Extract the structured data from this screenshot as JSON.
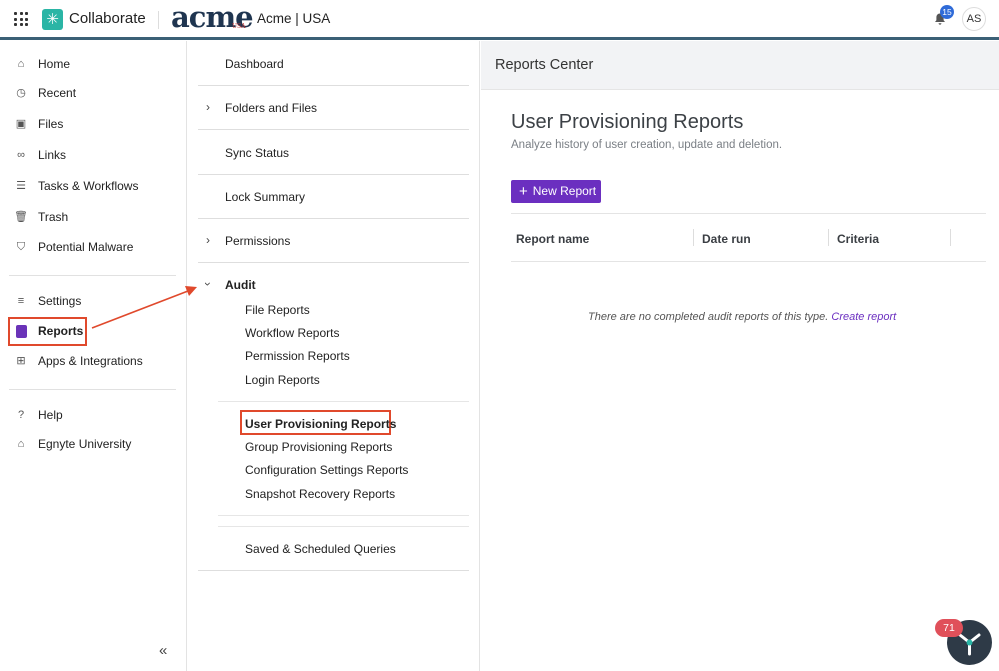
{
  "topbar": {
    "app_name": "Collaborate",
    "brand": "acme",
    "brand_sub": "USA",
    "tenant": "Acme | USA",
    "notification_count": "15",
    "avatar_initials": "AS"
  },
  "sidebar": {
    "items": [
      {
        "label": "Home",
        "icon": "home-icon"
      },
      {
        "label": "Recent",
        "icon": "clock-icon"
      },
      {
        "label": "Files",
        "icon": "files-icon"
      },
      {
        "label": "Links",
        "icon": "link-icon"
      },
      {
        "label": "Tasks & Workflows",
        "icon": "tasks-icon"
      },
      {
        "label": "Trash",
        "icon": "trash-icon"
      },
      {
        "label": "Potential Malware",
        "icon": "shield-icon"
      },
      {
        "label": "Settings",
        "icon": "sliders-icon"
      },
      {
        "label": "Reports",
        "icon": "reports-icon"
      },
      {
        "label": "Apps & Integrations",
        "icon": "apps-icon"
      },
      {
        "label": "Help",
        "icon": "help-icon"
      },
      {
        "label": "Egnyte University",
        "icon": "graduation-cap-icon"
      }
    ],
    "collapse_label": "«"
  },
  "reports_nav": {
    "dashboard": "Dashboard",
    "folders_and_files": "Folders and Files",
    "sync_status": "Sync Status",
    "lock_summary": "Lock Summary",
    "permissions": "Permissions",
    "audit": "Audit",
    "audit_items_1": [
      "File Reports",
      "Workflow Reports",
      "Permission Reports",
      "Login Reports"
    ],
    "audit_items_2": [
      "User Provisioning Reports",
      "Group Provisioning Reports",
      "Configuration Settings Reports",
      "Snapshot Recovery Reports"
    ],
    "saved_queries": "Saved & Scheduled Queries"
  },
  "main": {
    "header_title": "Reports Center",
    "title": "User Provisioning Reports",
    "subtitle": "Analyze history of user creation, update and deletion.",
    "new_report_button": "New Report",
    "columns": [
      "Report name",
      "Date run",
      "Criteria"
    ],
    "empty_text": "There are no completed audit reports of this type.",
    "empty_link": "Create report"
  },
  "chat": {
    "badge_count": "71"
  },
  "colors": {
    "accent": "#6b2fc0",
    "highlight": "#e0492c",
    "topbar_border": "#3b6076"
  }
}
